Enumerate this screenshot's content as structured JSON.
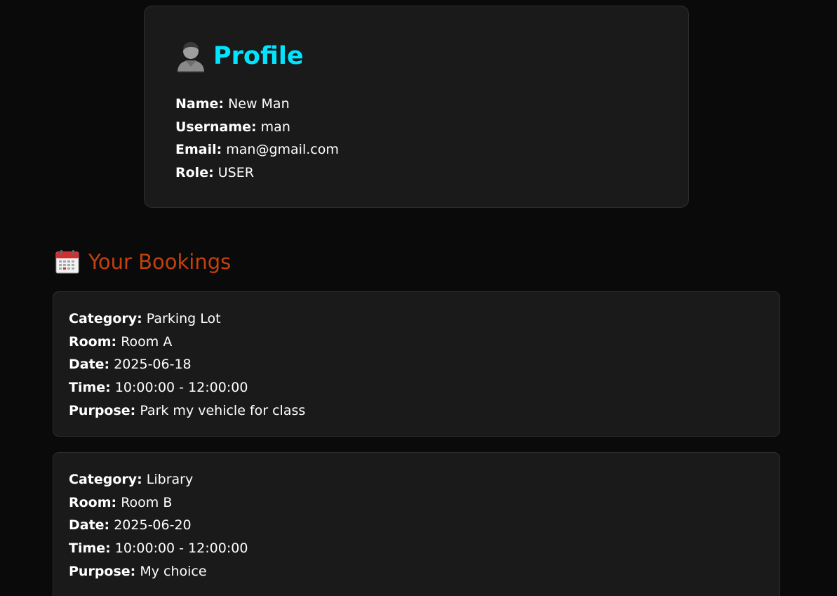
{
  "profile": {
    "icon": "user-silhouette-icon",
    "title": "Profile",
    "fields": [
      {
        "label": "Name:",
        "value": "New Man"
      },
      {
        "label": "Username:",
        "value": "man"
      },
      {
        "label": "Email:",
        "value": "man@gmail.com"
      },
      {
        "label": "Role:",
        "value": "USER"
      }
    ]
  },
  "bookings": {
    "icon": "calendar-icon",
    "title": "Your Bookings",
    "items": [
      {
        "category_label": "Category:",
        "category": "Parking Lot",
        "room_label": "Room:",
        "room": "Room A",
        "date_label": "Date:",
        "date": "2025-06-18",
        "time_label": "Time:",
        "time": "10:00:00 - 12:00:00",
        "purpose_label": "Purpose:",
        "purpose": "Park my vehicle for class"
      },
      {
        "category_label": "Category:",
        "category": "Library",
        "room_label": "Room:",
        "room": "Room B",
        "date_label": "Date:",
        "date": "2025-06-20",
        "time_label": "Time:",
        "time": "10:00:00 - 12:00:00",
        "purpose_label": "Purpose:",
        "purpose": "My choice"
      }
    ]
  },
  "colors": {
    "background": "#0a0a0a",
    "card": "#1a1a1a",
    "profile_title": "#00e5ff",
    "bookings_title": "#c2410c"
  }
}
